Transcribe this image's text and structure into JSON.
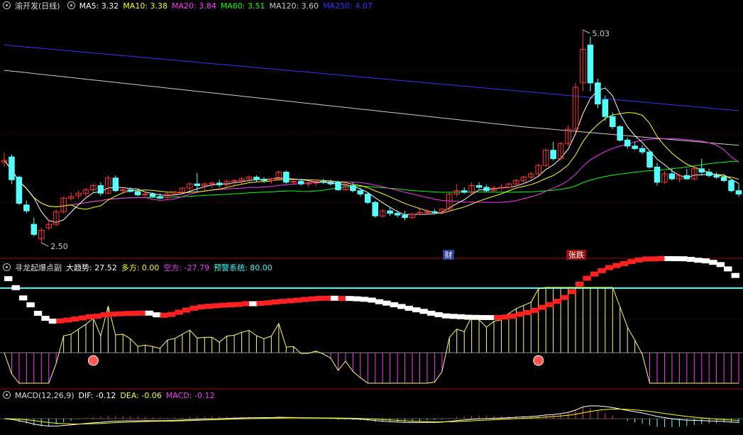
{
  "main": {
    "title": "渝开发(日线)",
    "ma_labels": [
      {
        "text": "MA5: 3.32",
        "color": "#ffffff"
      },
      {
        "text": "MA10: 3.38",
        "color": "#ffff00"
      },
      {
        "text": "MA20: 3.84",
        "color": "#ff33ff"
      },
      {
        "text": "MA60: 3.51",
        "color": "#00ff00"
      },
      {
        "text": "MA120: 3.60",
        "color": "#cccccc"
      },
      {
        "text": "MA250: 4.07",
        "color": "#3333ff"
      }
    ],
    "high_label": "5.03",
    "low_label": "2.50",
    "markers": [
      {
        "text": "财",
        "color": "#ffffff",
        "bg": "#2a3f9a"
      },
      {
        "text": "张跌",
        "color": "#ffffff",
        "bg": "#a01010"
      }
    ]
  },
  "indicator": {
    "name": "寻龙起爆点副",
    "labels": [
      {
        "text": "大趋势: 27.52",
        "color": "#ffffff"
      },
      {
        "text": "多方: 0.00",
        "color": "#ffff00"
      },
      {
        "text": "空方: -27.79",
        "color": "#ff33ff"
      },
      {
        "text": "预警系统: 80.00",
        "color": "#33ffff"
      }
    ]
  },
  "macd": {
    "name": "MACD(12,26,9)",
    "labels": [
      {
        "text": "DIF: -0.12",
        "color": "#ffffff"
      },
      {
        "text": "DEA: -0.06",
        "color": "#ffff00"
      },
      {
        "text": "MACD: -0.12",
        "color": "#ff33ff"
      }
    ]
  },
  "colors": {
    "up": "#ff3333",
    "down": "#54ffff",
    "grid": "#7a0000"
  },
  "chart_data": {
    "type": "candlestick",
    "ylim": [
      2.35,
      5.25
    ],
    "candles": [
      [
        3.46,
        3.57,
        3.4,
        3.48
      ],
      [
        3.52,
        3.55,
        3.2,
        3.25
      ],
      [
        3.28,
        3.3,
        2.95,
        2.97
      ],
      [
        2.95,
        3.0,
        2.85,
        2.88
      ],
      [
        2.72,
        2.8,
        2.58,
        2.6
      ],
      [
        2.55,
        2.68,
        2.5,
        2.65
      ],
      [
        2.68,
        2.78,
        2.65,
        2.72
      ],
      [
        2.72,
        2.9,
        2.7,
        2.87
      ],
      [
        2.87,
        3.05,
        2.85,
        3.03
      ],
      [
        3.03,
        3.1,
        3.0,
        3.05
      ],
      [
        3.06,
        3.12,
        3.02,
        3.09
      ],
      [
        3.09,
        3.15,
        3.05,
        3.13
      ],
      [
        3.13,
        3.2,
        3.1,
        3.18
      ],
      [
        3.18,
        3.22,
        3.06,
        3.09
      ],
      [
        3.09,
        3.3,
        3.08,
        3.27
      ],
      [
        3.27,
        3.3,
        3.1,
        3.12
      ],
      [
        3.12,
        3.15,
        3.08,
        3.13
      ],
      [
        3.13,
        3.16,
        3.1,
        3.11
      ],
      [
        3.11,
        3.13,
        3.05,
        3.07
      ],
      [
        3.07,
        3.1,
        3.05,
        3.08
      ],
      [
        3.08,
        3.1,
        3.04,
        3.05
      ],
      [
        3.05,
        3.09,
        3.02,
        3.03
      ],
      [
        3.04,
        3.1,
        3.02,
        3.08
      ],
      [
        3.08,
        3.12,
        3.06,
        3.1
      ],
      [
        3.1,
        3.16,
        3.08,
        3.15
      ],
      [
        3.15,
        3.22,
        3.12,
        3.2
      ],
      [
        3.2,
        3.33,
        3.1,
        3.18
      ],
      [
        3.18,
        3.22,
        3.12,
        3.2
      ],
      [
        3.2,
        3.23,
        3.15,
        3.21
      ],
      [
        3.21,
        3.25,
        3.16,
        3.19
      ],
      [
        3.19,
        3.25,
        3.16,
        3.23
      ],
      [
        3.23,
        3.26,
        3.18,
        3.24
      ],
      [
        3.24,
        3.28,
        3.2,
        3.26
      ],
      [
        3.26,
        3.3,
        3.22,
        3.28
      ],
      [
        3.28,
        3.3,
        3.22,
        3.25
      ],
      [
        3.25,
        3.28,
        3.21,
        3.24
      ],
      [
        3.24,
        3.27,
        3.2,
        3.26
      ],
      [
        3.26,
        3.36,
        3.24,
        3.34
      ],
      [
        3.34,
        3.36,
        3.2,
        3.22
      ],
      [
        3.22,
        3.25,
        3.19,
        3.23
      ],
      [
        3.23,
        3.26,
        3.18,
        3.2
      ],
      [
        3.2,
        3.24,
        3.17,
        3.21
      ],
      [
        3.21,
        3.25,
        3.18,
        3.23
      ],
      [
        3.23,
        3.26,
        3.2,
        3.22
      ],
      [
        3.22,
        3.25,
        3.18,
        3.2
      ],
      [
        3.22,
        3.24,
        3.12,
        3.13
      ],
      [
        3.13,
        3.2,
        3.12,
        3.18
      ],
      [
        3.18,
        3.22,
        3.1,
        3.12
      ],
      [
        3.12,
        3.15,
        3.05,
        3.08
      ],
      [
        3.08,
        3.1,
        2.96,
        2.98
      ],
      [
        2.98,
        3.0,
        2.8,
        2.82
      ],
      [
        2.82,
        2.9,
        2.8,
        2.88
      ],
      [
        2.88,
        2.92,
        2.82,
        2.85
      ],
      [
        2.85,
        2.88,
        2.8,
        2.83
      ],
      [
        2.83,
        2.88,
        2.77,
        2.8
      ],
      [
        2.8,
        2.86,
        2.78,
        2.84
      ],
      [
        2.84,
        2.92,
        2.83,
        2.86
      ],
      [
        2.86,
        2.9,
        2.84,
        2.87
      ],
      [
        2.87,
        2.9,
        2.85,
        2.86
      ],
      [
        2.86,
        2.92,
        2.85,
        2.9
      ],
      [
        2.9,
        3.1,
        2.88,
        3.08
      ],
      [
        3.08,
        3.2,
        3.05,
        3.12
      ],
      [
        3.12,
        3.16,
        3.08,
        3.1
      ],
      [
        3.1,
        3.22,
        3.08,
        3.18
      ],
      [
        3.18,
        3.22,
        3.14,
        3.16
      ],
      [
        3.16,
        3.19,
        3.1,
        3.12
      ],
      [
        3.12,
        3.18,
        3.1,
        3.15
      ],
      [
        3.15,
        3.2,
        3.12,
        3.16
      ],
      [
        3.16,
        3.22,
        3.14,
        3.2
      ],
      [
        3.2,
        3.26,
        3.18,
        3.24
      ],
      [
        3.24,
        3.3,
        3.2,
        3.28
      ],
      [
        3.28,
        3.34,
        3.25,
        3.32
      ],
      [
        3.32,
        3.44,
        3.3,
        3.42
      ],
      [
        3.42,
        3.62,
        3.4,
        3.6
      ],
      [
        3.6,
        3.7,
        3.48,
        3.5
      ],
      [
        3.5,
        3.7,
        3.48,
        3.68
      ],
      [
        3.68,
        3.9,
        3.65,
        3.85
      ],
      [
        3.85,
        4.4,
        3.8,
        4.35
      ],
      [
        4.4,
        5.03,
        4.3,
        4.8
      ],
      [
        4.85,
        4.95,
        4.3,
        4.4
      ],
      [
        4.4,
        4.45,
        4.1,
        4.15
      ],
      [
        4.2,
        4.25,
        3.95,
        4.0
      ],
      [
        4.0,
        4.05,
        3.85,
        3.88
      ],
      [
        3.88,
        3.9,
        3.7,
        3.72
      ],
      [
        3.72,
        3.75,
        3.62,
        3.65
      ],
      [
        3.65,
        3.7,
        3.6,
        3.62
      ],
      [
        3.62,
        3.66,
        3.55,
        3.58
      ],
      [
        3.58,
        3.6,
        3.38,
        3.4
      ],
      [
        3.4,
        3.45,
        3.18,
        3.22
      ],
      [
        3.22,
        3.35,
        3.2,
        3.32
      ],
      [
        3.32,
        3.38,
        3.24,
        3.26
      ],
      [
        3.26,
        3.32,
        3.22,
        3.3
      ],
      [
        3.3,
        3.38,
        3.25,
        3.26
      ],
      [
        3.26,
        3.42,
        3.24,
        3.38
      ],
      [
        3.38,
        3.5,
        3.3,
        3.34
      ],
      [
        3.34,
        3.38,
        3.28,
        3.3
      ],
      [
        3.3,
        3.34,
        3.26,
        3.28
      ],
      [
        3.28,
        3.3,
        3.22,
        3.24
      ],
      [
        3.24,
        3.26,
        3.1,
        3.12
      ],
      [
        3.12,
        3.2,
        3.05,
        3.08
      ]
    ]
  }
}
